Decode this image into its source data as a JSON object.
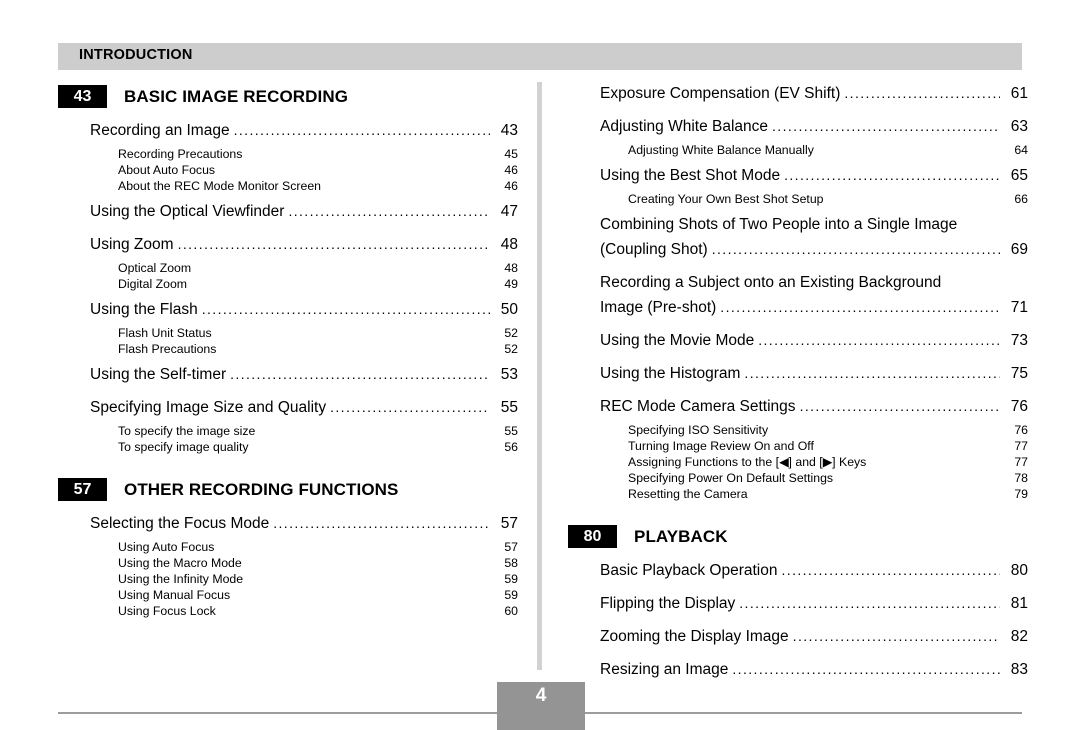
{
  "document": {
    "running_header": "INTRODUCTION",
    "page_number": "4",
    "colors": {
      "header_band": "#cdcdcd",
      "badge_bg": "#000000",
      "badge_fg": "#ffffff",
      "divider": "#d2d2d2",
      "footer_rule": "#9c9c9c",
      "page_box": "#949494"
    }
  },
  "left_column": {
    "sections": [
      {
        "badge": "43",
        "title": "BASIC IMAGE RECORDING",
        "entries": [
          {
            "level": 1,
            "label": "Recording an Image",
            "page": "43",
            "leader": true
          },
          {
            "level": 2,
            "label": "Recording Precautions",
            "page": "45",
            "leader": false
          },
          {
            "level": 2,
            "label": "About Auto Focus",
            "page": "46",
            "leader": false
          },
          {
            "level": 2,
            "label": "About the REC Mode Monitor Screen",
            "page": "46",
            "leader": false
          },
          {
            "level": 1,
            "label": "Using the Optical Viewfinder",
            "page": "47",
            "leader": true
          },
          {
            "level": 1,
            "label": "Using Zoom",
            "page": "48",
            "leader": true
          },
          {
            "level": 2,
            "label": "Optical Zoom",
            "page": "48",
            "leader": false
          },
          {
            "level": 2,
            "label": "Digital Zoom",
            "page": "49",
            "leader": false
          },
          {
            "level": 1,
            "label": "Using the Flash",
            "page": "50",
            "leader": true
          },
          {
            "level": 2,
            "label": "Flash Unit Status",
            "page": "52",
            "leader": false
          },
          {
            "level": 2,
            "label": "Flash Precautions",
            "page": "52",
            "leader": false
          },
          {
            "level": 1,
            "label": "Using the Self-timer",
            "page": "53",
            "leader": true
          },
          {
            "level": 1,
            "label": "Specifying Image Size and Quality",
            "page": "55",
            "leader": true
          },
          {
            "level": 2,
            "label": "To specify the image size",
            "page": "55",
            "leader": false
          },
          {
            "level": 2,
            "label": "To specify image quality",
            "page": "56",
            "leader": false
          }
        ]
      },
      {
        "badge": "57",
        "title": "OTHER RECORDING FUNCTIONS",
        "entries": [
          {
            "level": 1,
            "label": "Selecting the Focus Mode",
            "page": "57",
            "leader": true
          },
          {
            "level": 2,
            "label": "Using Auto Focus",
            "page": "57",
            "leader": false
          },
          {
            "level": 2,
            "label": "Using the Macro Mode",
            "page": "58",
            "leader": false
          },
          {
            "level": 2,
            "label": "Using the Infinity Mode",
            "page": "59",
            "leader": false
          },
          {
            "level": 2,
            "label": "Using Manual Focus",
            "page": "59",
            "leader": false
          },
          {
            "level": 2,
            "label": "Using Focus Lock",
            "page": "60",
            "leader": false
          }
        ]
      }
    ]
  },
  "right_column": {
    "top_entries": [
      {
        "level": 1,
        "label": "Exposure Compensation (EV Shift)",
        "page": "61",
        "leader": true
      },
      {
        "level": 1,
        "label": "Adjusting White Balance",
        "page": "63",
        "leader": true
      },
      {
        "level": 2,
        "label": "Adjusting White Balance Manually",
        "page": "64",
        "leader": false
      },
      {
        "level": 1,
        "label": "Using the Best Shot Mode",
        "page": "65",
        "leader": true
      },
      {
        "level": 2,
        "label": "Creating Your Own Best Shot Setup",
        "page": "66",
        "leader": false
      },
      {
        "level": 1,
        "label": "Combining Shots of Two People into a Single Image",
        "page": "",
        "leader": false,
        "wrap_first": true
      },
      {
        "level": 1,
        "label": "(Coupling Shot)",
        "page": "69",
        "leader": true
      },
      {
        "level": 1,
        "label": "Recording a Subject onto an Existing Background",
        "page": "",
        "leader": false,
        "wrap_first": true
      },
      {
        "level": 1,
        "label": "Image (Pre-shot)",
        "page": "71",
        "leader": true
      },
      {
        "level": 1,
        "label": "Using the Movie Mode",
        "page": "73",
        "leader": true
      },
      {
        "level": 1,
        "label": "Using the Histogram",
        "page": "75",
        "leader": true
      },
      {
        "level": 1,
        "label": "REC Mode Camera Settings",
        "page": "76",
        "leader": true
      },
      {
        "level": 2,
        "label": "Specifying ISO Sensitivity",
        "page": "76",
        "leader": false
      },
      {
        "level": 2,
        "label": "Turning Image Review On and Off",
        "page": "77",
        "leader": false
      },
      {
        "level": 2,
        "label": "Assigning Functions to the [◀] and [▶] Keys",
        "page": "77",
        "leader": false
      },
      {
        "level": 2,
        "label": "Specifying Power On Default Settings",
        "page": "78",
        "leader": false
      },
      {
        "level": 2,
        "label": "Resetting the Camera",
        "page": "79",
        "leader": false
      }
    ],
    "sections": [
      {
        "badge": "80",
        "title": "PLAYBACK",
        "entries": [
          {
            "level": 1,
            "label": "Basic Playback Operation",
            "page": "80",
            "leader": true
          },
          {
            "level": 1,
            "label": "Flipping the Display",
            "page": "81",
            "leader": true
          },
          {
            "level": 1,
            "label": "Zooming the Display Image",
            "page": "82",
            "leader": true
          },
          {
            "level": 1,
            "label": "Resizing an Image",
            "page": "83",
            "leader": true
          }
        ]
      }
    ]
  }
}
